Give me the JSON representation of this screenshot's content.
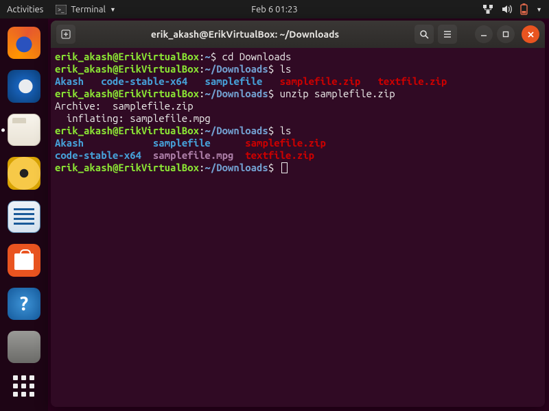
{
  "topbar": {
    "activities": "Activities",
    "app_name": "Terminal",
    "datetime": "Feb 6  01:23"
  },
  "dock": {
    "items": [
      {
        "name": "firefox"
      },
      {
        "name": "thunderbird"
      },
      {
        "name": "files",
        "active": true
      },
      {
        "name": "rhythmbox"
      },
      {
        "name": "writer"
      },
      {
        "name": "software"
      },
      {
        "name": "help"
      },
      {
        "name": "trash"
      }
    ]
  },
  "window": {
    "title": "erik_akash@ErikVirtualBox: ~/Downloads"
  },
  "prompt": {
    "user": "erik_akash@ErikVirtualBox",
    "home_path": "~",
    "dl_path": "~/Downloads",
    "sep": ":",
    "symbol": "$"
  },
  "cmds": {
    "cd": " cd Downloads",
    "ls": " ls",
    "unzip": " unzip samplefile.zip"
  },
  "output": {
    "archive": "Archive:  samplefile.zip",
    "inflate": "  inflating: samplefile.mpg",
    "ls1_akash": "Akash",
    "ls1_sp1": "   ",
    "ls1_code": "code-stable-x64",
    "ls1_sp2": "   ",
    "ls1_sample": "samplefile",
    "ls1_sp3": "   ",
    "ls1_zip": "samplefile.zip",
    "ls1_sp4": "   ",
    "ls1_txt": "textfile.zip",
    "ls2_akash": "Akash",
    "ls2_sp1": "            ",
    "ls2_sample": "samplefile",
    "ls2_sp2": "      ",
    "ls2_zip": "samplefile.zip",
    "ls2_code": "code-stable-x64",
    "ls2_sp3": "  ",
    "ls2_mpg": "samplefile.mpg",
    "ls2_sp4": "  ",
    "ls2_txt": "textfile.zip"
  },
  "help_q": "?"
}
